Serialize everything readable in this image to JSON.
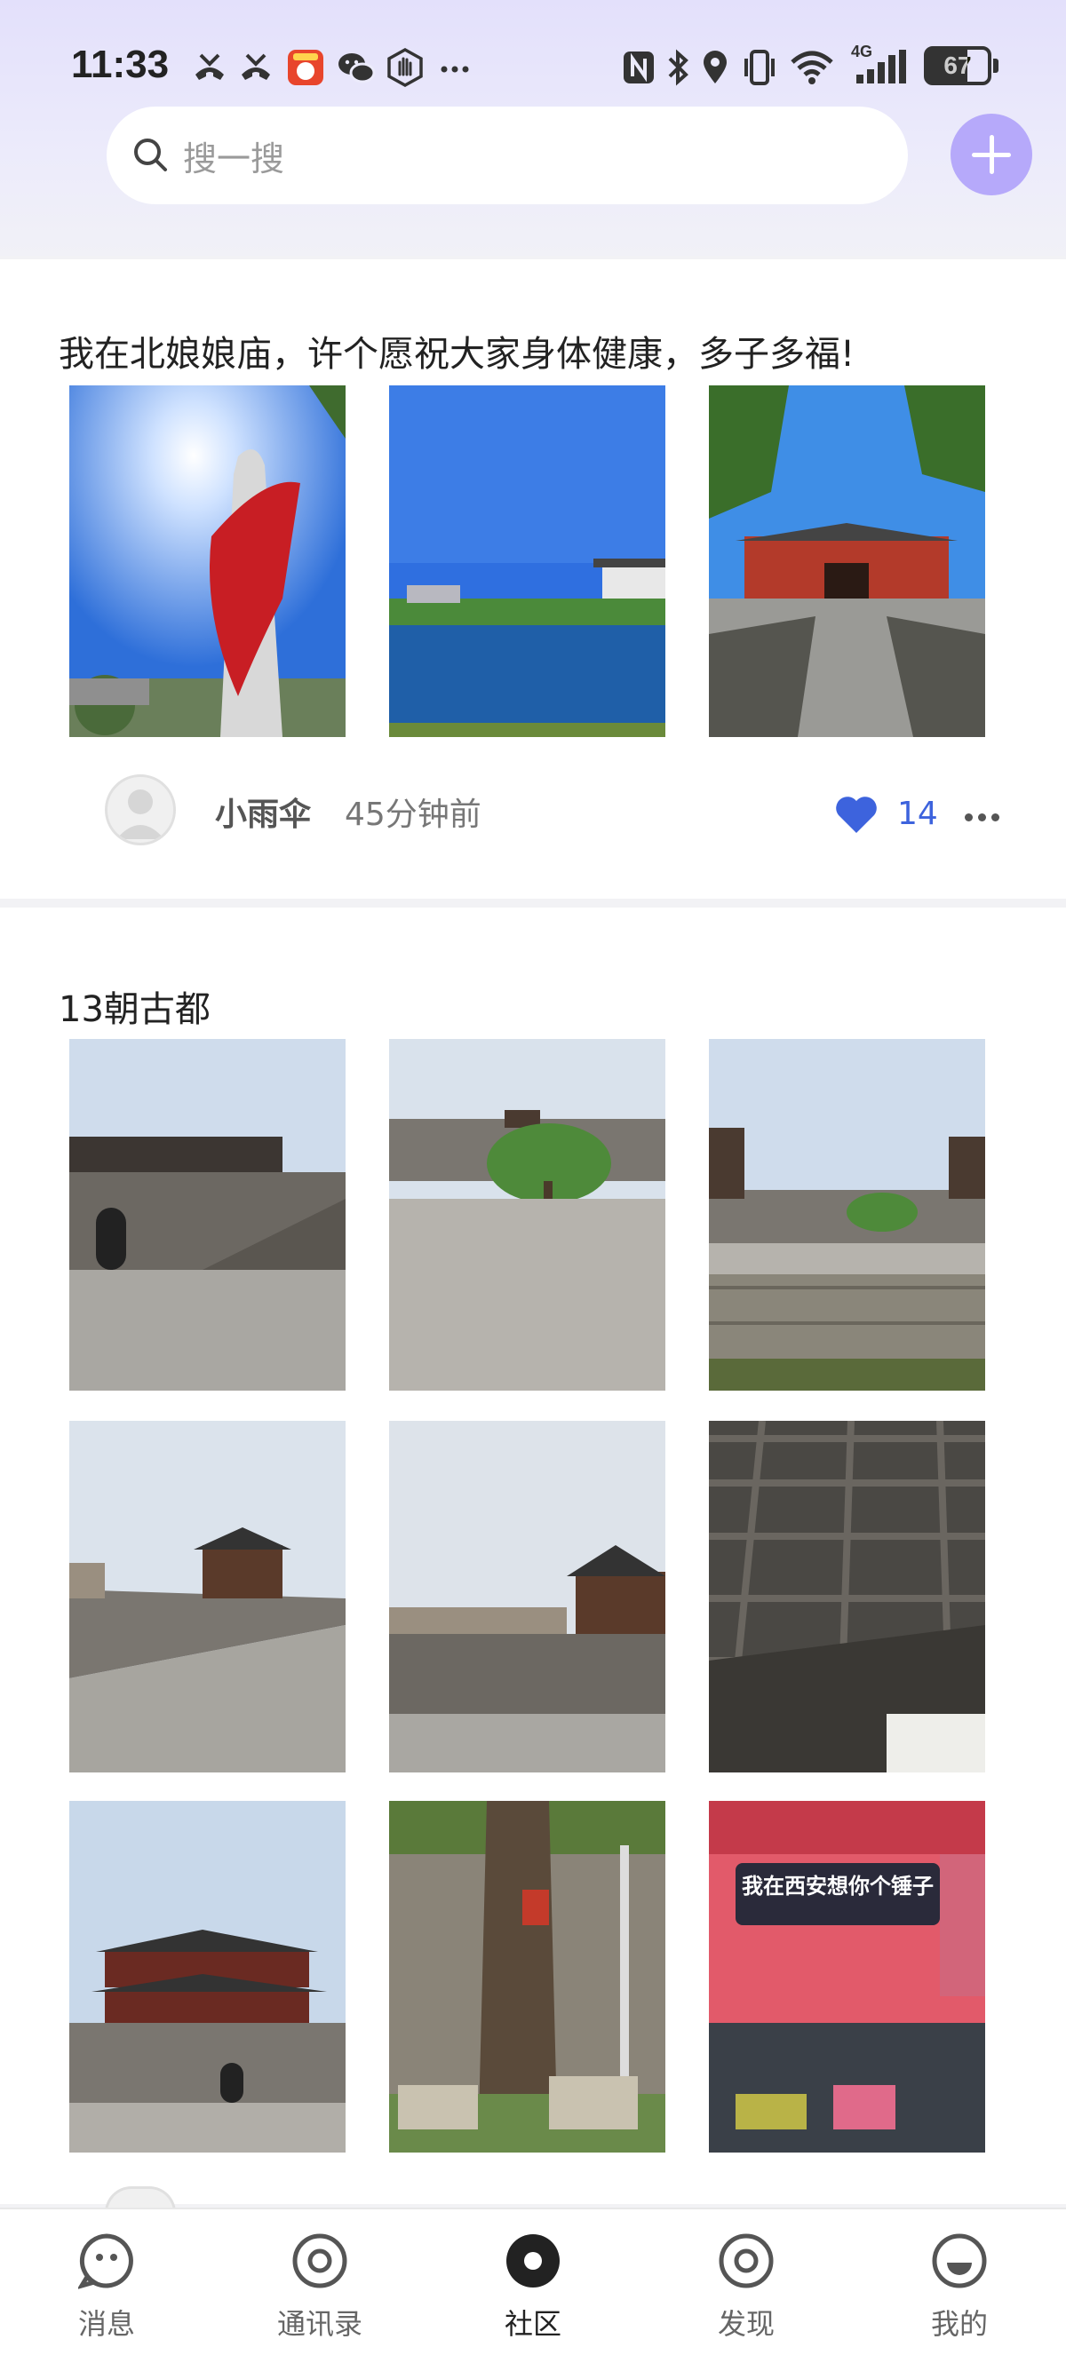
{
  "status_bar": {
    "time": "11:33",
    "battery": "67",
    "network": "4G",
    "icons": [
      "missed-call-icon",
      "missed-call-icon",
      "app-notification-icon",
      "wechat-icon",
      "hand-icon",
      "more-dots-icon",
      "nfc-icon",
      "bluetooth-icon",
      "location-icon",
      "vibrate-icon",
      "wifi-icon",
      "signal-icon",
      "battery-icon"
    ]
  },
  "search": {
    "placeholder": "搜一搜"
  },
  "posts": [
    {
      "text": "我在北娘娘庙，许个愿祝大家身体健康，多子多福!",
      "author": "小雨伞",
      "time": "45分钟前",
      "likes": "14",
      "photos": [
        "torch-sculpture-photo",
        "lake-photo",
        "temple-gate-photo"
      ]
    },
    {
      "text": "13朝古都",
      "photos": [
        "city-gate-photo",
        "wall-plaza-tree-photo",
        "wall-courtyard-photo",
        "wall-walkway-photo",
        "wall-tower-photo",
        "city-model-photo",
        "gate-tower-photo",
        "old-tree-photo",
        "shop-sign-photo"
      ],
      "sign_text": "我在西安想你个锤子"
    }
  ],
  "nav": [
    {
      "label": "消息",
      "icon": "chat-icon"
    },
    {
      "label": "通讯录",
      "icon": "contacts-icon"
    },
    {
      "label": "社区",
      "icon": "community-icon",
      "active": true
    },
    {
      "label": "发现",
      "icon": "discover-icon"
    },
    {
      "label": "我的",
      "icon": "profile-icon"
    }
  ],
  "colors": {
    "accent": "#b6a9fa",
    "like": "#3d63dd",
    "header": "#e3e0fb"
  }
}
